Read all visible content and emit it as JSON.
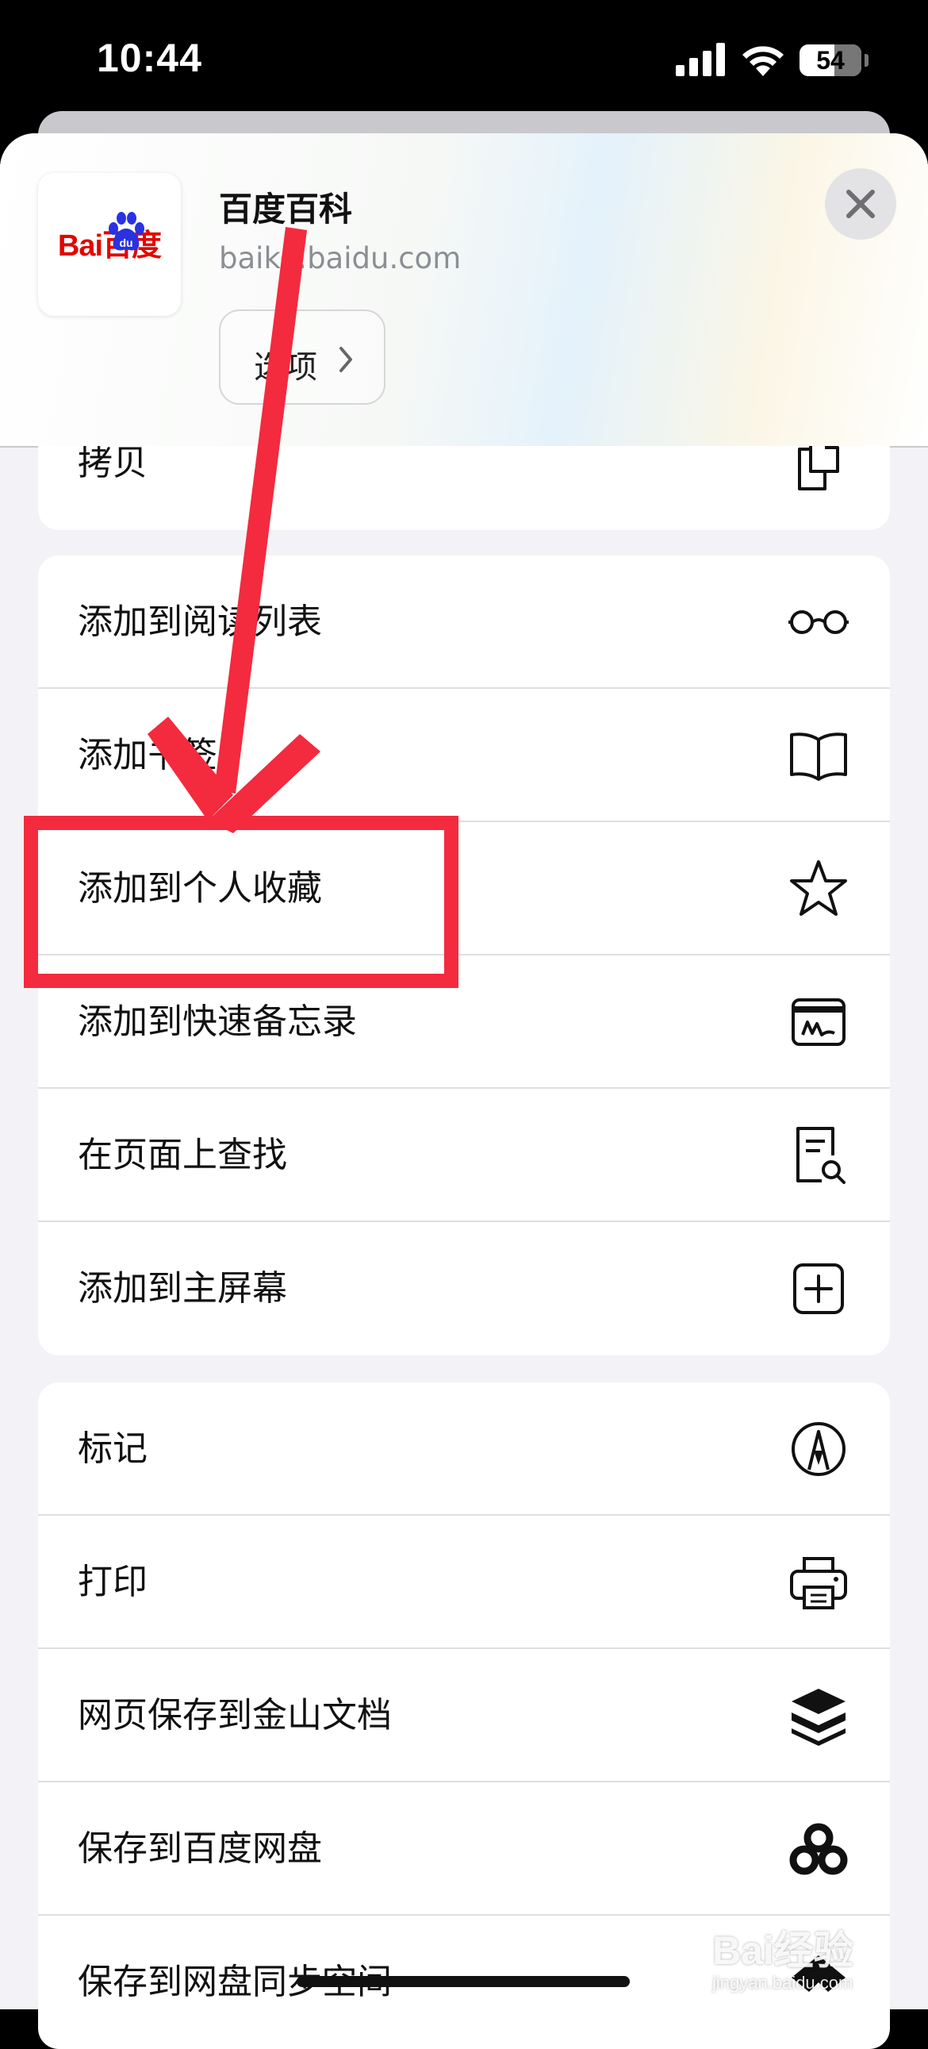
{
  "status_bar": {
    "time": "10:44",
    "battery": "54"
  },
  "share_header": {
    "site_title": "百度百科",
    "site_url": "baike.baidu.com",
    "options_label": "选项",
    "logo_text": "Bai百度"
  },
  "groups": [
    {
      "items": [
        {
          "label": "拷贝",
          "icon": "copy-icon"
        }
      ]
    },
    {
      "items": [
        {
          "label": "添加到阅读列表",
          "icon": "glasses-icon"
        },
        {
          "label": "添加书签",
          "icon": "book-icon"
        },
        {
          "label": "添加到个人收藏",
          "icon": "star-icon"
        },
        {
          "label": "添加到快速备忘录",
          "icon": "quick-note-icon"
        },
        {
          "label": "在页面上查找",
          "icon": "find-on-page-icon"
        },
        {
          "label": "添加到主屏幕",
          "icon": "add-square-icon"
        }
      ]
    },
    {
      "items": [
        {
          "label": "标记",
          "icon": "markup-icon"
        },
        {
          "label": "打印",
          "icon": "printer-icon"
        },
        {
          "label": "网页保存到金山文档",
          "icon": "kingsoft-docs-icon"
        },
        {
          "label": "保存到百度网盘",
          "icon": "baidu-netdisk-icon"
        },
        {
          "label": "保存到网盘同步空间",
          "icon": "sync-space-icon"
        }
      ]
    }
  ],
  "annotation": {
    "color": "#f42a3e",
    "highlighted_item": "添加到个人收藏"
  },
  "watermark": {
    "text": "Bai经验",
    "sub": "jingyan.baidu.com"
  }
}
